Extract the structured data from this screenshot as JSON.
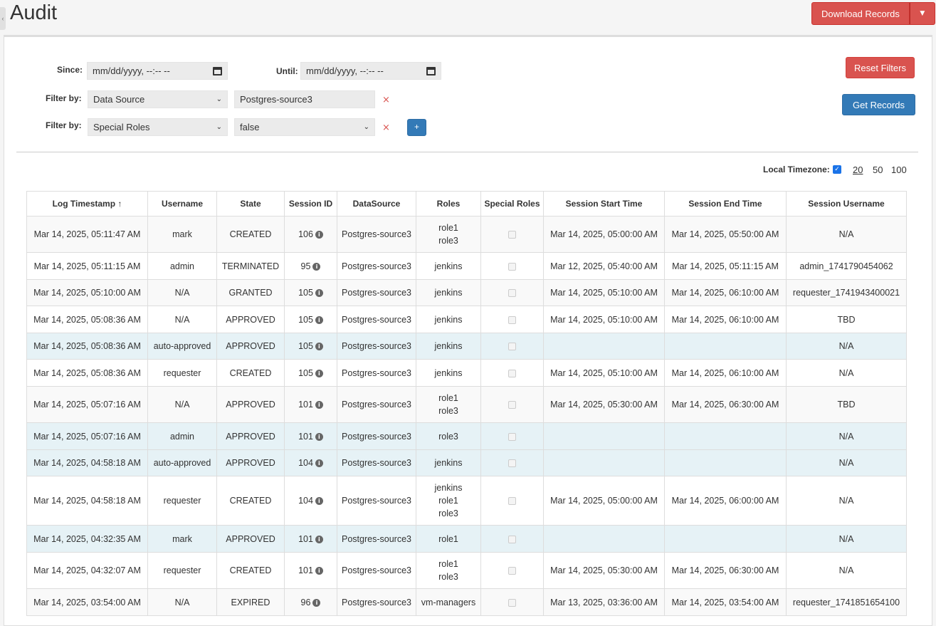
{
  "header": {
    "title": "Audit",
    "download_label": "Download Records",
    "download_caret": "▼"
  },
  "filters": {
    "since_label": "Since:",
    "since_placeholder": "mm/dd/yyyy, --:-- --",
    "until_label": "Until:",
    "until_placeholder": "mm/dd/yyyy, --:-- --",
    "filter_label": "Filter by:",
    "rows": [
      {
        "field": "Data Source",
        "value": "Postgres-source3",
        "remove": "×"
      },
      {
        "field": "Special Roles",
        "value": "false",
        "remove": "×"
      }
    ],
    "add_label": "+",
    "reset_label": "Reset Filters",
    "get_label": "Get Records"
  },
  "options": {
    "timezone_label": "Local Timezone:",
    "timezone_checked": true,
    "page_sizes": [
      "20",
      "50",
      "100"
    ],
    "active_page_size": "20"
  },
  "table": {
    "columns": [
      "Log Timestamp ↑",
      "Username",
      "State",
      "Session ID",
      "DataSource",
      "Roles",
      "Special Roles",
      "Session Start Time",
      "Session End Time",
      "Session Username"
    ],
    "rows": [
      {
        "ts": "Mar 14, 2025, 05:11:47 AM",
        "user": "mark",
        "state": "CREATED",
        "sid": "106",
        "ds": "Postgres-source3",
        "roles": [
          "role1",
          "role3"
        ],
        "start": "Mar 14, 2025, 05:00:00 AM",
        "end": "Mar 14, 2025, 05:50:00 AM",
        "suser": "N/A",
        "hl": false
      },
      {
        "ts": "Mar 14, 2025, 05:11:15 AM",
        "user": "admin",
        "state": "TERMINATED",
        "sid": "95",
        "ds": "Postgres-source3",
        "roles": [
          "jenkins"
        ],
        "start": "Mar 12, 2025, 05:40:00 AM",
        "end": "Mar 14, 2025, 05:11:15 AM",
        "suser": "admin_1741790454062",
        "hl": false
      },
      {
        "ts": "Mar 14, 2025, 05:10:00 AM",
        "user": "N/A",
        "state": "GRANTED",
        "sid": "105",
        "ds": "Postgres-source3",
        "roles": [
          "jenkins"
        ],
        "start": "Mar 14, 2025, 05:10:00 AM",
        "end": "Mar 14, 2025, 06:10:00 AM",
        "suser": "requester_1741943400021",
        "hl": false
      },
      {
        "ts": "Mar 14, 2025, 05:08:36 AM",
        "user": "N/A",
        "state": "APPROVED",
        "sid": "105",
        "ds": "Postgres-source3",
        "roles": [
          "jenkins"
        ],
        "start": "Mar 14, 2025, 05:10:00 AM",
        "end": "Mar 14, 2025, 06:10:00 AM",
        "suser": "TBD",
        "hl": false
      },
      {
        "ts": "Mar 14, 2025, 05:08:36 AM",
        "user": "auto-approved",
        "state": "APPROVED",
        "sid": "105",
        "ds": "Postgres-source3",
        "roles": [
          "jenkins"
        ],
        "start": "",
        "end": "",
        "suser": "N/A",
        "hl": true
      },
      {
        "ts": "Mar 14, 2025, 05:08:36 AM",
        "user": "requester",
        "state": "CREATED",
        "sid": "105",
        "ds": "Postgres-source3",
        "roles": [
          "jenkins"
        ],
        "start": "Mar 14, 2025, 05:10:00 AM",
        "end": "Mar 14, 2025, 06:10:00 AM",
        "suser": "N/A",
        "hl": false
      },
      {
        "ts": "Mar 14, 2025, 05:07:16 AM",
        "user": "N/A",
        "state": "APPROVED",
        "sid": "101",
        "ds": "Postgres-source3",
        "roles": [
          "role1",
          "role3"
        ],
        "start": "Mar 14, 2025, 05:30:00 AM",
        "end": "Mar 14, 2025, 06:30:00 AM",
        "suser": "TBD",
        "hl": false
      },
      {
        "ts": "Mar 14, 2025, 05:07:16 AM",
        "user": "admin",
        "state": "APPROVED",
        "sid": "101",
        "ds": "Postgres-source3",
        "roles": [
          "role3"
        ],
        "start": "",
        "end": "",
        "suser": "N/A",
        "hl": true
      },
      {
        "ts": "Mar 14, 2025, 04:58:18 AM",
        "user": "auto-approved",
        "state": "APPROVED",
        "sid": "104",
        "ds": "Postgres-source3",
        "roles": [
          "jenkins"
        ],
        "start": "",
        "end": "",
        "suser": "N/A",
        "hl": true
      },
      {
        "ts": "Mar 14, 2025, 04:58:18 AM",
        "user": "requester",
        "state": "CREATED",
        "sid": "104",
        "ds": "Postgres-source3",
        "roles": [
          "jenkins",
          "role1",
          "role3"
        ],
        "start": "Mar 14, 2025, 05:00:00 AM",
        "end": "Mar 14, 2025, 06:00:00 AM",
        "suser": "N/A",
        "hl": false
      },
      {
        "ts": "Mar 14, 2025, 04:32:35 AM",
        "user": "mark",
        "state": "APPROVED",
        "sid": "101",
        "ds": "Postgres-source3",
        "roles": [
          "role1"
        ],
        "start": "",
        "end": "",
        "suser": "N/A",
        "hl": true
      },
      {
        "ts": "Mar 14, 2025, 04:32:07 AM",
        "user": "requester",
        "state": "CREATED",
        "sid": "101",
        "ds": "Postgres-source3",
        "roles": [
          "role1",
          "role3"
        ],
        "start": "Mar 14, 2025, 05:30:00 AM",
        "end": "Mar 14, 2025, 06:30:00 AM",
        "suser": "N/A",
        "hl": false
      },
      {
        "ts": "Mar 14, 2025, 03:54:00 AM",
        "user": "N/A",
        "state": "EXPIRED",
        "sid": "96",
        "ds": "Postgres-source3",
        "roles": [
          "vm-managers"
        ],
        "start": "Mar 13, 2025, 03:36:00 AM",
        "end": "Mar 14, 2025, 03:54:00 AM",
        "suser": "requester_1741851654100",
        "hl": false
      }
    ]
  }
}
